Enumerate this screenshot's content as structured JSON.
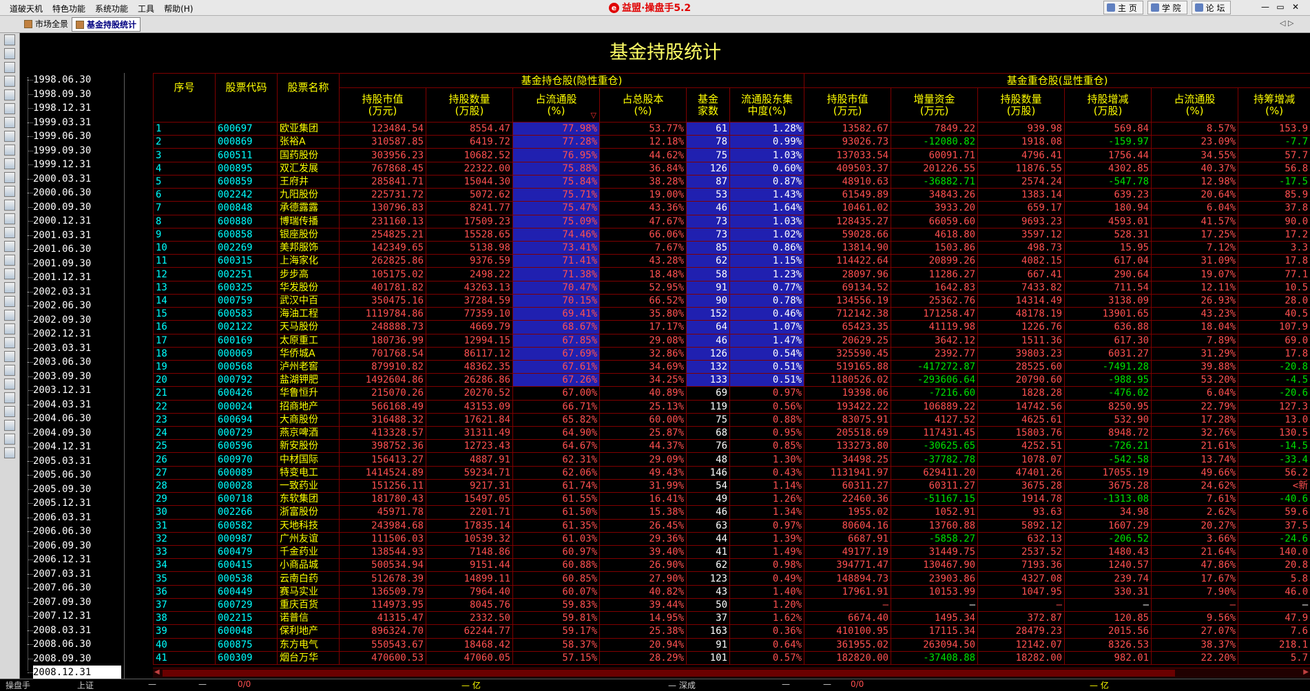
{
  "menubar": {
    "items": [
      "道破天机",
      "特色功能",
      "系统功能",
      "工具",
      "帮助(H)"
    ],
    "brand_logo": "e",
    "brand": "益盟·操盘手5.2",
    "links": [
      "主 页",
      "学 院",
      "论 坛"
    ],
    "window_controls": [
      "—",
      "▭",
      "✕"
    ]
  },
  "tabs": [
    {
      "label": "市场全景",
      "active": false
    },
    {
      "label": "基金持股统计",
      "active": true
    }
  ],
  "tab_arrows": "◁ ▷",
  "title": "基金持股统计",
  "dates": [
    "1998.06.30",
    "1998.09.30",
    "1998.12.31",
    "1999.03.31",
    "1999.06.30",
    "1999.09.30",
    "1999.12.31",
    "2000.03.31",
    "2000.06.30",
    "2000.09.30",
    "2000.12.31",
    "2001.03.31",
    "2001.06.30",
    "2001.09.30",
    "2001.12.31",
    "2002.03.31",
    "2002.06.30",
    "2002.09.30",
    "2002.12.31",
    "2003.03.31",
    "2003.06.30",
    "2003.09.30",
    "2003.12.31",
    "2004.03.31",
    "2004.06.30",
    "2004.09.30",
    "2004.12.31",
    "2005.03.31",
    "2005.06.30",
    "2005.09.30",
    "2005.12.31",
    "2006.03.31",
    "2006.06.30",
    "2006.09.30",
    "2006.12.31",
    "2007.03.31",
    "2007.06.30",
    "2007.09.30",
    "2007.12.31",
    "2008.03.31",
    "2008.06.30",
    "2008.09.30",
    "2008.12.31"
  ],
  "selected_date": "2008.12.31",
  "table": {
    "group_headers": [
      "基金持仓股(隐性重仓)",
      "基金重仓股(显性重仓)"
    ],
    "columns": [
      "序号",
      "股票代码",
      "股票名称",
      "持股市值\n(万元)",
      "持股数量\n(万股)",
      "占流通股\n(%)",
      "占总股本\n(%)",
      "基金\n家数",
      "流通股东集\n中度(%)",
      "持股市值\n(万元)",
      "增量资金\n(万元)",
      "持股数量\n(万股)",
      "持股增减\n(万股)",
      "占流通股\n(%)",
      "持筹增减\n(%)"
    ],
    "sort_marker": "▽",
    "rows": [
      [
        "1",
        "600697",
        "欧亚集团",
        "123484.54",
        "8554.47",
        "77.98%",
        "53.77%",
        "61",
        "1.28%",
        "13582.67",
        "7849.22",
        "939.98",
        "569.84",
        "8.57%",
        "153.9"
      ],
      [
        "2",
        "000869",
        "张裕A",
        "310587.85",
        "6419.72",
        "77.28%",
        "12.18%",
        "78",
        "0.99%",
        "93026.73",
        "-12080.82",
        "1918.08",
        "-159.97",
        "23.09%",
        "-7.7"
      ],
      [
        "3",
        "600511",
        "国药股份",
        "303956.23",
        "10682.52",
        "76.95%",
        "44.62%",
        "75",
        "1.03%",
        "137033.54",
        "60091.71",
        "4796.41",
        "1756.44",
        "34.55%",
        "57.7"
      ],
      [
        "4",
        "000895",
        "双汇发展",
        "767868.45",
        "22322.00",
        "75.88%",
        "36.84%",
        "126",
        "0.60%",
        "409503.37",
        "201226.55",
        "11876.55",
        "4302.85",
        "40.37%",
        "56.8"
      ],
      [
        "5",
        "600859",
        "王府井",
        "285841.71",
        "15044.30",
        "75.84%",
        "38.28%",
        "87",
        "0.87%",
        "48910.63",
        "-36882.71",
        "2574.24",
        "-547.78",
        "12.98%",
        "-17.5"
      ],
      [
        "6",
        "002242",
        "九阳股份",
        "225731.72",
        "5072.62",
        "75.71%",
        "19.00%",
        "53",
        "1.43%",
        "61549.89",
        "34843.26",
        "1383.14",
        "639.23",
        "20.64%",
        "85.9"
      ],
      [
        "7",
        "000848",
        "承德露露",
        "130796.83",
        "8241.77",
        "75.47%",
        "43.36%",
        "46",
        "1.64%",
        "10461.02",
        "3933.20",
        "659.17",
        "180.94",
        "6.04%",
        "37.8"
      ],
      [
        "8",
        "600880",
        "博瑞传播",
        "231160.13",
        "17509.23",
        "75.09%",
        "47.67%",
        "73",
        "1.03%",
        "128435.27",
        "66059.60",
        "9693.23",
        "4593.01",
        "41.57%",
        "90.0"
      ],
      [
        "9",
        "600858",
        "银座股份",
        "254825.21",
        "15528.65",
        "74.46%",
        "66.06%",
        "73",
        "1.02%",
        "59028.66",
        "4618.80",
        "3597.12",
        "528.31",
        "17.25%",
        "17.2"
      ],
      [
        "10",
        "002269",
        "美邦服饰",
        "142349.65",
        "5138.98",
        "73.41%",
        "7.67%",
        "85",
        "0.86%",
        "13814.90",
        "1503.86",
        "498.73",
        "15.95",
        "7.12%",
        "3.3"
      ],
      [
        "11",
        "600315",
        "上海家化",
        "262825.86",
        "9376.59",
        "71.41%",
        "43.28%",
        "62",
        "1.15%",
        "114422.64",
        "20899.26",
        "4082.15",
        "617.04",
        "31.09%",
        "17.8"
      ],
      [
        "12",
        "002251",
        "步步高",
        "105175.02",
        "2498.22",
        "71.38%",
        "18.48%",
        "58",
        "1.23%",
        "28097.96",
        "11286.27",
        "667.41",
        "290.64",
        "19.07%",
        "77.1"
      ],
      [
        "13",
        "600325",
        "华发股份",
        "401781.82",
        "43263.13",
        "70.47%",
        "52.95%",
        "91",
        "0.77%",
        "69134.52",
        "1642.83",
        "7433.82",
        "711.54",
        "12.11%",
        "10.5"
      ],
      [
        "14",
        "000759",
        "武汉中百",
        "350475.16",
        "37284.59",
        "70.15%",
        "66.52%",
        "90",
        "0.78%",
        "134556.19",
        "25362.76",
        "14314.49",
        "3138.09",
        "26.93%",
        "28.0"
      ],
      [
        "15",
        "600583",
        "海油工程",
        "1119784.86",
        "77359.10",
        "69.41%",
        "35.80%",
        "152",
        "0.46%",
        "712142.38",
        "171258.47",
        "48178.19",
        "13901.65",
        "43.23%",
        "40.5"
      ],
      [
        "16",
        "002122",
        "天马股份",
        "248888.73",
        "4669.79",
        "68.67%",
        "17.17%",
        "64",
        "1.07%",
        "65423.35",
        "41119.98",
        "1226.76",
        "636.88",
        "18.04%",
        "107.9"
      ],
      [
        "17",
        "600169",
        "太原重工",
        "180736.99",
        "12994.15",
        "67.85%",
        "29.08%",
        "46",
        "1.47%",
        "20629.25",
        "3642.12",
        "1511.36",
        "617.30",
        "7.89%",
        "69.0"
      ],
      [
        "18",
        "000069",
        "华侨城A",
        "701768.54",
        "86117.12",
        "67.69%",
        "32.86%",
        "126",
        "0.54%",
        "325590.45",
        "2392.77",
        "39803.23",
        "6031.27",
        "31.29%",
        "17.8"
      ],
      [
        "19",
        "000568",
        "泸州老窖",
        "879910.82",
        "48362.35",
        "67.61%",
        "34.69%",
        "132",
        "0.51%",
        "519165.88",
        "-417272.87",
        "28525.60",
        "-7491.28",
        "39.88%",
        "-20.8"
      ],
      [
        "20",
        "000792",
        "盐湖钾肥",
        "1492604.86",
        "26286.86",
        "67.26%",
        "34.25%",
        "133",
        "0.51%",
        "1180526.02",
        "-293606.64",
        "20790.60",
        "-988.95",
        "53.20%",
        "-4.5"
      ],
      [
        "21",
        "600426",
        "华鲁恒升",
        "215070.26",
        "20270.52",
        "67.00%",
        "40.89%",
        "69",
        "0.97%",
        "19398.06",
        "-7216.60",
        "1828.28",
        "-476.02",
        "6.04%",
        "-20.6"
      ],
      [
        "22",
        "000024",
        "招商地产",
        "566168.49",
        "43153.09",
        "66.71%",
        "25.13%",
        "119",
        "0.56%",
        "193422.22",
        "106889.22",
        "14742.56",
        "8250.95",
        "22.79%",
        "127.3"
      ],
      [
        "23",
        "600694",
        "大商股份",
        "316488.32",
        "17621.84",
        "65.82%",
        "60.00%",
        "75",
        "0.88%",
        "83075.91",
        "4127.52",
        "4625.61",
        "532.90",
        "17.28%",
        "13.0"
      ],
      [
        "24",
        "000729",
        "燕京啤酒",
        "413328.57",
        "31311.49",
        "64.90%",
        "25.87%",
        "68",
        "0.95%",
        "205518.69",
        "117431.45",
        "15803.76",
        "8948.72",
        "32.76%",
        "130.5"
      ],
      [
        "25",
        "600596",
        "新安股份",
        "398752.36",
        "12723.43",
        "64.67%",
        "44.37%",
        "76",
        "0.85%",
        "133273.80",
        "-30625.65",
        "4252.51",
        "-726.21",
        "21.61%",
        "-14.5"
      ],
      [
        "26",
        "600970",
        "中材国际",
        "156413.27",
        "4887.91",
        "62.31%",
        "29.09%",
        "48",
        "1.30%",
        "34498.25",
        "-37782.78",
        "1078.07",
        "-542.58",
        "13.74%",
        "-33.4"
      ],
      [
        "27",
        "600089",
        "特变电工",
        "1414524.89",
        "59234.71",
        "62.06%",
        "49.43%",
        "146",
        "0.43%",
        "1131941.97",
        "629411.20",
        "47401.26",
        "17055.19",
        "49.66%",
        "56.2"
      ],
      [
        "28",
        "000028",
        "一致药业",
        "151256.11",
        "9217.31",
        "61.74%",
        "31.99%",
        "54",
        "1.14%",
        "60311.27",
        "60311.27",
        "3675.28",
        "3675.28",
        "24.62%",
        "<新"
      ],
      [
        "29",
        "600718",
        "东软集团",
        "181780.43",
        "15497.05",
        "61.55%",
        "16.41%",
        "49",
        "1.26%",
        "22460.36",
        "-51167.15",
        "1914.78",
        "-1313.08",
        "7.61%",
        "-40.6"
      ],
      [
        "30",
        "002266",
        "浙富股份",
        "45971.78",
        "2201.71",
        "61.50%",
        "15.38%",
        "46",
        "1.34%",
        "1955.02",
        "1052.91",
        "93.63",
        "34.98",
        "2.62%",
        "59.6"
      ],
      [
        "31",
        "600582",
        "天地科技",
        "243984.68",
        "17835.14",
        "61.35%",
        "26.45%",
        "63",
        "0.97%",
        "80604.16",
        "13760.88",
        "5892.12",
        "1607.29",
        "20.27%",
        "37.5"
      ],
      [
        "32",
        "000987",
        "广州友谊",
        "111506.03",
        "10539.32",
        "61.03%",
        "29.36%",
        "44",
        "1.39%",
        "6687.91",
        "-5858.27",
        "632.13",
        "-206.52",
        "3.66%",
        "-24.6"
      ],
      [
        "33",
        "600479",
        "千金药业",
        "138544.93",
        "7148.86",
        "60.97%",
        "39.40%",
        "41",
        "1.49%",
        "49177.19",
        "31449.75",
        "2537.52",
        "1480.43",
        "21.64%",
        "140.0"
      ],
      [
        "34",
        "600415",
        "小商品城",
        "500534.94",
        "9151.44",
        "60.88%",
        "26.90%",
        "62",
        "0.98%",
        "394771.47",
        "130467.90",
        "7193.36",
        "1240.57",
        "47.86%",
        "20.8"
      ],
      [
        "35",
        "000538",
        "云南白药",
        "512678.39",
        "14899.11",
        "60.85%",
        "27.90%",
        "123",
        "0.49%",
        "148894.73",
        "23903.86",
        "4327.08",
        "239.74",
        "17.67%",
        "5.8"
      ],
      [
        "36",
        "600449",
        "赛马实业",
        "136509.79",
        "7964.40",
        "60.07%",
        "40.82%",
        "43",
        "1.40%",
        "17961.91",
        "10153.99",
        "1047.95",
        "330.31",
        "7.90%",
        "46.0"
      ],
      [
        "37",
        "600729",
        "重庆百货",
        "114973.95",
        "8045.76",
        "59.83%",
        "39.44%",
        "50",
        "1.20%",
        "—",
        "—",
        "—",
        "—",
        "—",
        "—"
      ],
      [
        "38",
        "002215",
        "诺普信",
        "41315.47",
        "2332.50",
        "59.81%",
        "14.95%",
        "37",
        "1.62%",
        "6674.40",
        "1495.34",
        "372.87",
        "120.85",
        "9.56%",
        "47.9"
      ],
      [
        "39",
        "600048",
        "保利地产",
        "896324.70",
        "62244.77",
        "59.17%",
        "25.38%",
        "163",
        "0.36%",
        "410100.95",
        "17115.34",
        "28479.23",
        "2015.56",
        "27.07%",
        "7.6"
      ],
      [
        "40",
        "600875",
        "东方电气",
        "550543.67",
        "18468.42",
        "58.37%",
        "20.94%",
        "91",
        "0.64%",
        "361955.02",
        "263094.50",
        "12142.07",
        "8326.53",
        "38.37%",
        "218.1"
      ],
      [
        "41",
        "600309",
        "烟台万华",
        "470600.53",
        "47060.05",
        "57.15%",
        "28.29%",
        "101",
        "0.57%",
        "182820.00",
        "-37408.88",
        "18282.00",
        "982.01",
        "22.20%",
        "5.7"
      ]
    ]
  },
  "status": {
    "brand": "操盘手",
    "sh_label": "上证",
    "dash1": "—",
    "dash2": "—",
    "sh_ratio": "0/0",
    "sh_amount": "— 亿",
    "sz_label": "— 深成",
    "dash3": "—",
    "dash4": "—",
    "sz_ratio": "0/0",
    "sz_amount": "— 亿"
  },
  "colors": {
    "background": "#000000",
    "title": "#ffff66",
    "header_text": "#ffff00",
    "grid_line": "#800000",
    "code": "#00ffff",
    "up": "#ff5050",
    "down": "#00e000",
    "highlight": "#2020b0"
  }
}
